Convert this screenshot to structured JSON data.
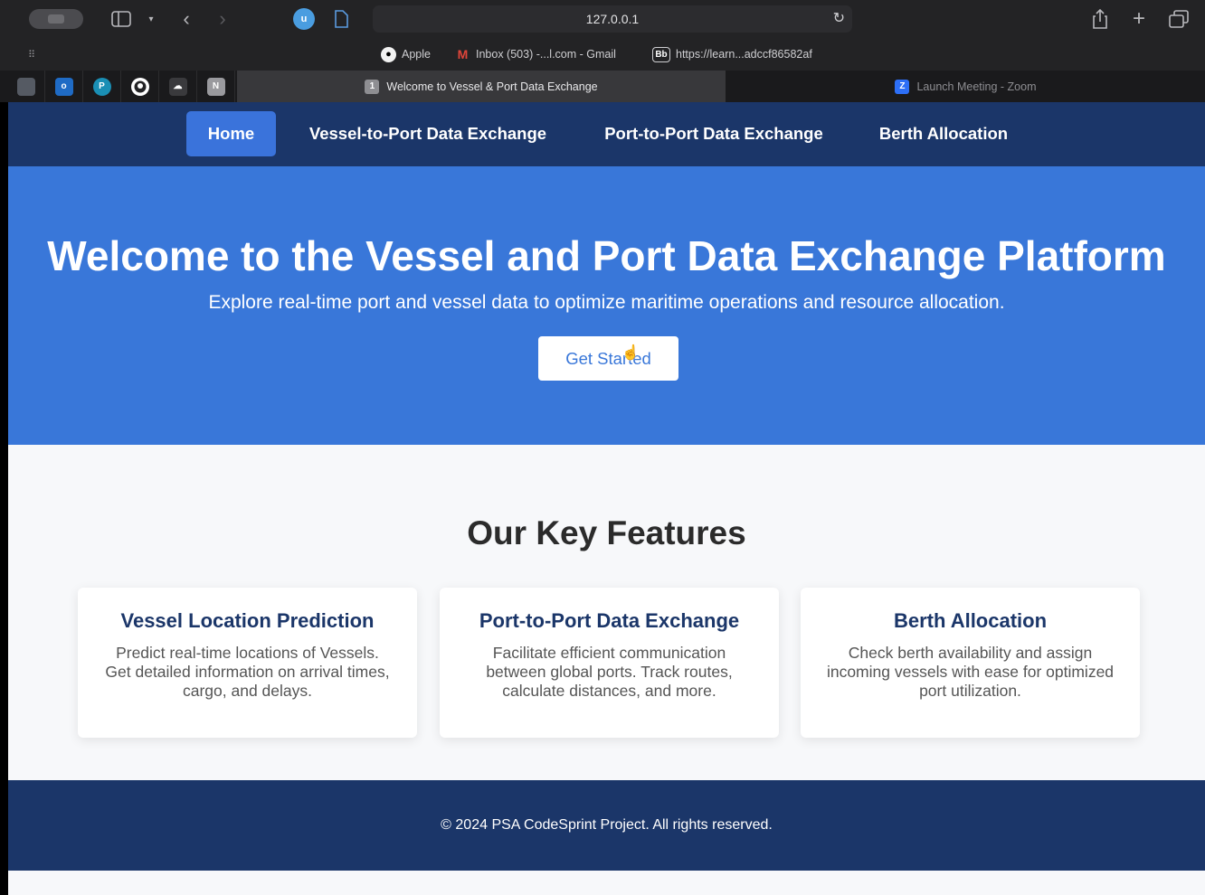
{
  "browser": {
    "address": "127.0.0.1",
    "extension_label": "u",
    "favorites": [
      {
        "label": "Apple",
        "icon": "apple-icon"
      },
      {
        "label": "Inbox (503) -...l.com - Gmail",
        "icon": "gmail-icon"
      },
      {
        "label": "https://learn...adccf86582af",
        "icon": "blackboard-icon",
        "icon_text": "Bb"
      }
    ],
    "pinned_tabs": [
      {
        "icon": "pinned-app-icon",
        "text": "",
        "color": "#555a63"
      },
      {
        "icon": "outlook-icon",
        "text": "",
        "color": "#1f6bc5"
      },
      {
        "icon": "pinned-p-icon",
        "text": "P",
        "color": "#1a8fb5"
      },
      {
        "icon": "github-icon",
        "text": "",
        "color": "#232325"
      },
      {
        "icon": "pinned-cloud-icon",
        "text": "",
        "color": "#3a3a3d"
      },
      {
        "icon": "notion-icon",
        "text": "N",
        "color": "#9a9a9e"
      }
    ],
    "tabs": [
      {
        "title": "Welcome to Vessel & Port Data Exchange",
        "icon_text": "1",
        "active": true
      },
      {
        "title": "Launch Meeting - Zoom",
        "icon_text": "Z",
        "active": false
      }
    ]
  },
  "nav": {
    "items": [
      {
        "label": "Home",
        "active": true
      },
      {
        "label": "Vessel-to-Port Data Exchange",
        "active": false
      },
      {
        "label": "Port-to-Port Data Exchange",
        "active": false
      },
      {
        "label": "Berth Allocation",
        "active": false
      }
    ]
  },
  "hero": {
    "title": "Welcome to the Vessel and Port Data Exchange Platform",
    "subtitle": "Explore real-time port and vessel data to optimize maritime operations and resource allocation.",
    "cta_label": "Get Started"
  },
  "features": {
    "title": "Our Key Features",
    "cards": [
      {
        "title": "Vessel Location Prediction",
        "text": "Predict real-time locations of Vessels. Get detailed information on arrival times, cargo, and delays."
      },
      {
        "title": "Port-to-Port Data Exchange",
        "text": "Facilitate efficient communication between global ports. Track routes, calculate distances, and more."
      },
      {
        "title": "Berth Allocation",
        "text": "Check berth availability and assign incoming vessels with ease for optimized port utilization."
      }
    ]
  },
  "footer": {
    "text": "© 2024 PSA CodeSprint Project. All rights reserved."
  },
  "colors": {
    "nav_bg": "#1b3669",
    "hero_bg": "#3977d9",
    "accent": "#3a73db",
    "card_title": "#1b3669"
  }
}
